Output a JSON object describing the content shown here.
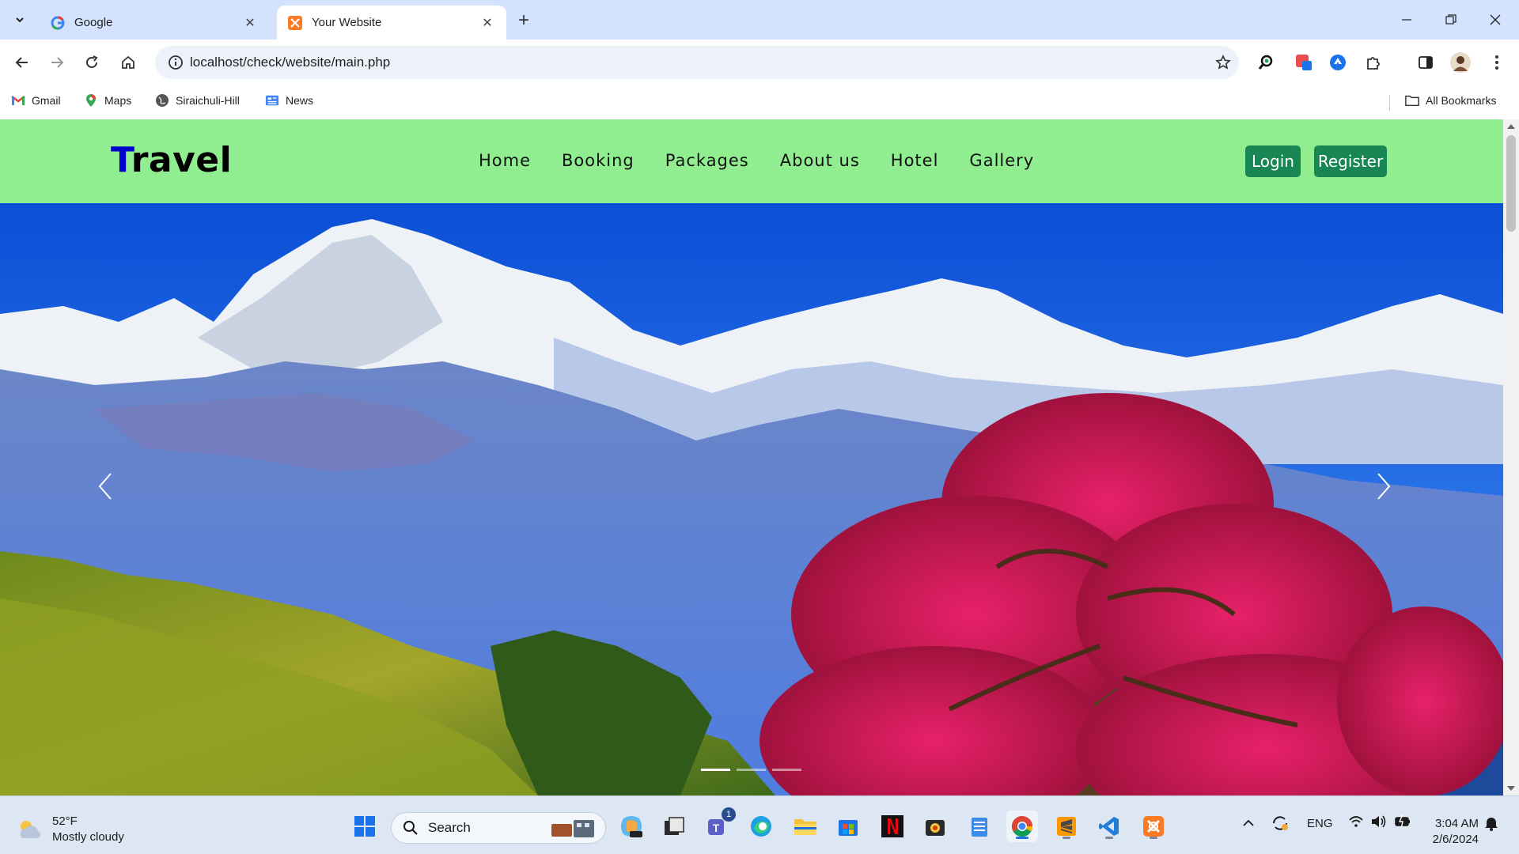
{
  "browser": {
    "tabs": [
      {
        "title": "Google",
        "favicon": "google-g-icon",
        "active": false
      },
      {
        "title": "Your Website",
        "favicon": "xampp-icon",
        "active": true
      }
    ],
    "url": "localhost/check/website/main.php",
    "bookmarks": [
      {
        "label": "Gmail",
        "icon": "gmail-icon"
      },
      {
        "label": "Maps",
        "icon": "maps-pin-icon"
      },
      {
        "label": "Siraichuli-Hill",
        "icon": "globe-icon"
      },
      {
        "label": "News",
        "icon": "news-icon"
      }
    ],
    "all_bookmarks_label": "All Bookmarks"
  },
  "site": {
    "brand_first": "T",
    "brand_rest": "ravel",
    "nav": [
      "Home",
      "Booking",
      "Packages",
      "About us",
      "Hotel",
      "Gallery"
    ],
    "login_label": "Login",
    "register_label": "Register",
    "accent_color": "#198754",
    "header_color": "#90ee90",
    "carousel": {
      "slides": 3,
      "active_slide": 1
    }
  },
  "taskbar": {
    "weather_temp": "52°F",
    "weather_desc": "Mostly cloudy",
    "search_placeholder": "Search",
    "teams_badge": "1",
    "language": "ENG",
    "time": "3:04 AM",
    "date": "2/6/2024"
  }
}
